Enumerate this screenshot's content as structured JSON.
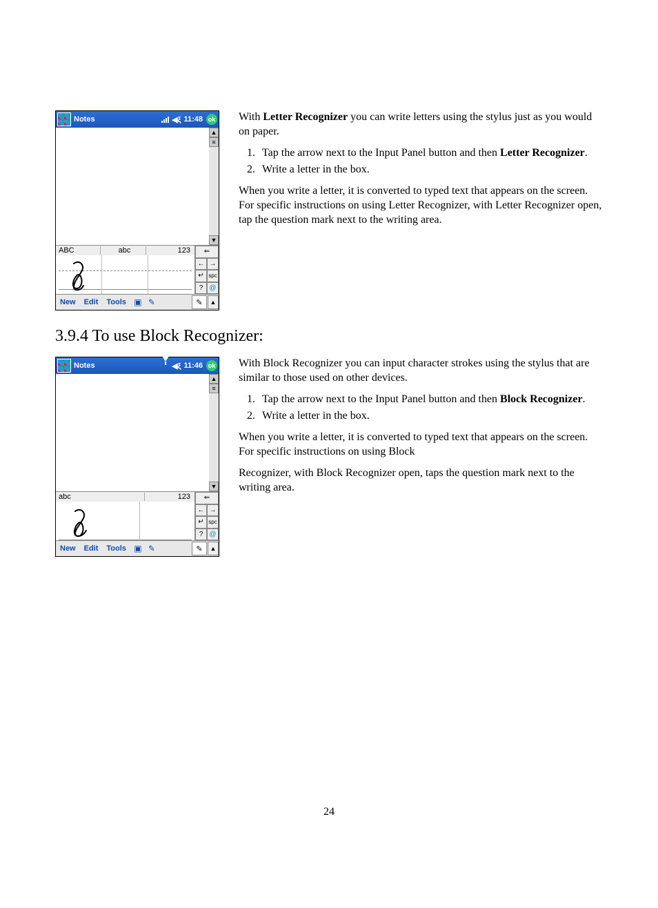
{
  "page_number": "24",
  "section_heading": "3.9.4 To use Block Recognizer:",
  "letter": {
    "intro_pre": "With ",
    "intro_bold": "Letter Recognizer",
    "intro_post": " you can write letters using the stylus just as you would on paper.",
    "step1_pre": "Tap the arrow next to the Input Panel button and then ",
    "step1_bold": "Letter Recognizer",
    "step1_post": ".",
    "step2": "Write a letter in the box.",
    "para2": "When you write a letter, it is converted to typed text that appears on the screen. For specific instructions on using Letter Recognizer, with Letter Recognizer open, tap the question mark next to the writing area."
  },
  "block": {
    "intro": "With Block Recognizer you can input character strokes using the stylus that are similar to those used on other devices.",
    "step1_pre": "Tap the arrow next to the Input Panel button and then ",
    "step1_bold": "Block Recognizer",
    "step1_post": ".",
    "step2": "Write a letter in the box.",
    "para2": "When you write a letter, it is converted to typed text that appears on the screen. For specific instructions on using Block",
    "para3": "Recognizer, with Block Recognizer open, taps the question mark next to the writing area."
  },
  "pda1": {
    "title": "Notes",
    "time": "11:48",
    "ok": "ok",
    "zones": {
      "a": "ABC",
      "b": "abc",
      "c": "123"
    },
    "keys": {
      "bksp": "⇐",
      "left": "←",
      "right": "→",
      "enter": "↵",
      "spc": "spc",
      "help": "?",
      "sym": "@"
    },
    "menu": {
      "new": "New",
      "edit": "Edit",
      "tools": "Tools"
    }
  },
  "pda2": {
    "title": "Notes",
    "time": "11:46",
    "ok": "ok",
    "zones": {
      "a": "abc",
      "b": "123"
    },
    "keys": {
      "bksp": "⇐",
      "left": "←",
      "right": "→",
      "enter": "↵",
      "spc": "spc",
      "help": "?",
      "sym": "@"
    },
    "menu": {
      "new": "New",
      "edit": "Edit",
      "tools": "Tools"
    }
  }
}
